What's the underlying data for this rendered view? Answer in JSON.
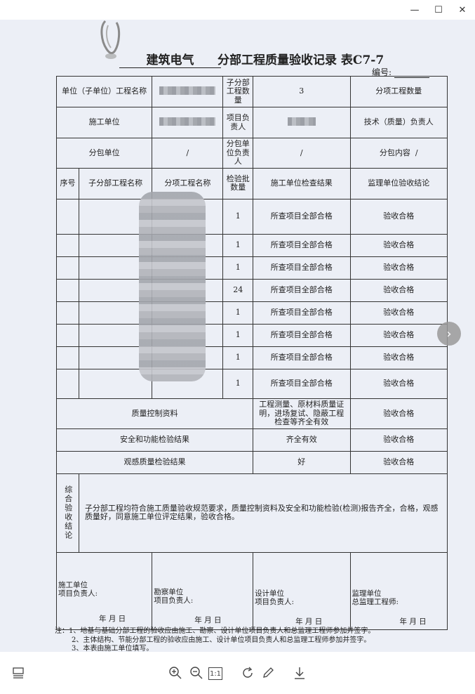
{
  "window": {
    "minimize": "—",
    "maximize": "☐",
    "close": "✕"
  },
  "form": {
    "blank_value": "建筑电气",
    "title": "分部工程质量验收记录  表C7-7",
    "number_label": "编号:",
    "header": {
      "unit_label": "单位（子单位）工程名称",
      "subunit_count_label": "子分部工程数量",
      "subunit_count": "3",
      "item_count_label": "分项工程数量",
      "contractor_label": "施工单位",
      "pm_label": "项目负责人",
      "tech_label": "技术（质量）负责人",
      "subcontract_label": "分包单位",
      "subcontract_value": "/",
      "sub_pm_label": "分包单位负责人",
      "sub_pm_value": "/",
      "sub_content_label": "分包内容",
      "sub_content_value": "/"
    },
    "columns": [
      "序号",
      "子分部工程名称",
      "分项工程名称",
      "检验批数量",
      "施工单位检查结果",
      "监理单位验收结论"
    ],
    "rows": [
      {
        "count": "1",
        "check": "所查项目全部合格",
        "verdict": "验收合格"
      },
      {
        "count": "1",
        "check": "所查项目全部合格",
        "verdict": "验收合格"
      },
      {
        "count": "1",
        "check": "所查项目全部合格",
        "verdict": "验收合格"
      },
      {
        "count": "24",
        "check": "所查项目全部合格",
        "verdict": "验收合格"
      },
      {
        "count": "1",
        "check": "所查项目全部合格",
        "verdict": "验收合格"
      },
      {
        "count": "1",
        "check": "所查项目全部合格",
        "verdict": "验收合格"
      },
      {
        "count": "1",
        "check": "所查项目全部合格",
        "verdict": "验收合格"
      },
      {
        "count": "1",
        "check": "所查项目全部合格",
        "verdict": "验收合格"
      }
    ],
    "quality": {
      "label": "质量控制资料",
      "check": "工程测量、原材料质量证明，进场复试、隐蔽工程检查等齐全有效",
      "verdict": "验收合格"
    },
    "safety": {
      "label": "安全和功能检验结果",
      "check": "齐全有效",
      "verdict": "验收合格"
    },
    "appearance": {
      "label": "观感质量检验结果",
      "check": "好",
      "verdict": "验收合格"
    },
    "conclusion": {
      "label": "综合验收结论",
      "text": "子分部工程均符合施工质量验收规范要求，质量控制资料及安全和功能检验(检测)报告齐全，合格，观感质量好，同意施工单位评定结果，验收合格。"
    },
    "signatures": [
      {
        "label": "施工单位\n项目负责人:",
        "date": "年  月  日"
      },
      {
        "label": "勘察单位\n项目负责人:",
        "date": "年  月  日"
      },
      {
        "label": "设计单位\n项目负责人:",
        "date": "年  月  日"
      },
      {
        "label": "监理单位\n总监理工程师:",
        "date": "年  月  日"
      }
    ],
    "notes": [
      "注：1、地基与基础分部工程的验收应由施工、勘察、设计单位项目负责人和总监理工程师参加并签字。",
      "2、主体结构、节能分部工程的验收应由施工、设计单位项目负责人和总监理工程师参加并签字。",
      "3、本表由施工单位填写。"
    ]
  },
  "toolbar": {
    "thumbnails": "thumbnails-icon",
    "zoom_in": "zoom-in-icon",
    "zoom_out": "zoom-out-icon",
    "actual_size": "1:1",
    "rotate": "rotate-icon",
    "edit": "edit-icon",
    "download": "download-icon"
  }
}
